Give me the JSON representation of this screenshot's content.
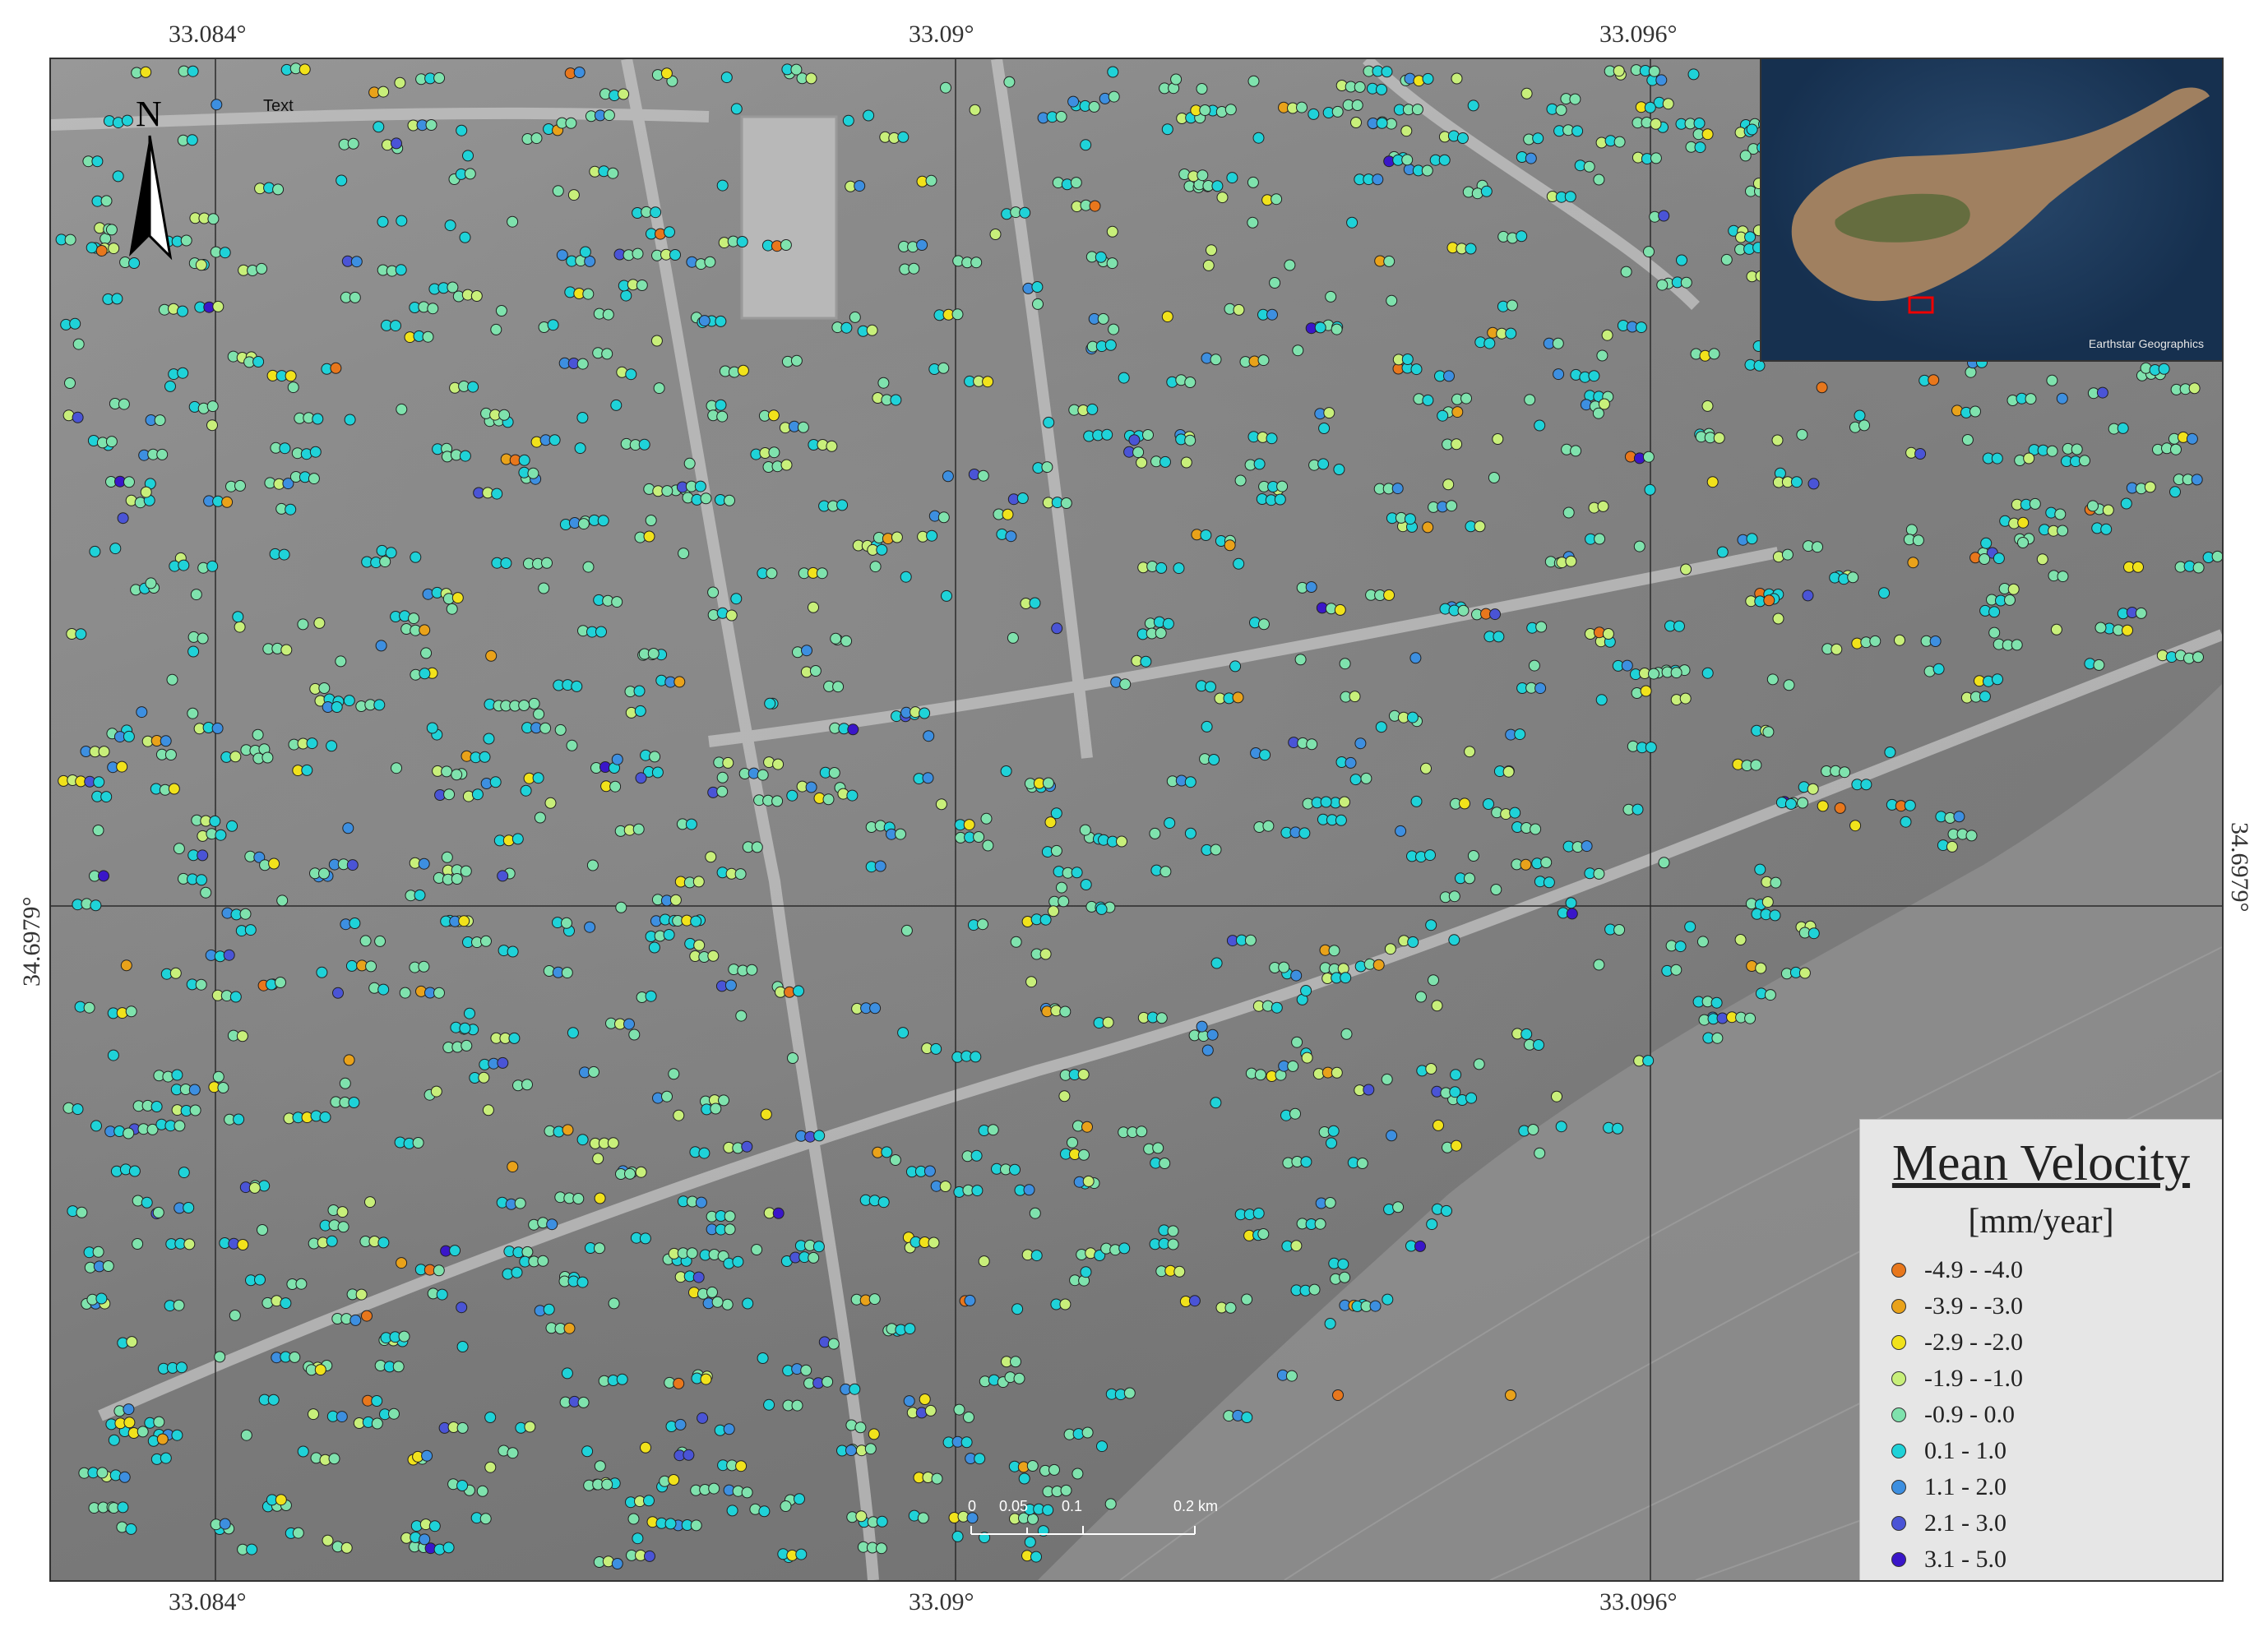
{
  "coordinates": {
    "top": [
      "33.084°",
      "33.09°",
      "33.096°"
    ],
    "bottom": [
      "33.084°",
      "33.09°",
      "33.096°"
    ],
    "left": [
      "34.6979°"
    ],
    "right": [
      "34.6979°"
    ]
  },
  "north_label": "N",
  "map_text": "Text",
  "inset": {
    "credit": "Earthstar Geographics"
  },
  "legend": {
    "title": "Mean Velocity",
    "unit": "[mm/year]",
    "classes": [
      {
        "label": "-4.9 - -4.0",
        "color": "#e8771c"
      },
      {
        "label": "-3.9 - -3.0",
        "color": "#e9a21a"
      },
      {
        "label": "-2.9 - -2.0",
        "color": "#f1e21b"
      },
      {
        "label": "-1.9 - -1.0",
        "color": "#c8ef7a"
      },
      {
        "label": "-0.9 - 0.0",
        "color": "#7fe2ad"
      },
      {
        "label": "0.1 - 1.0",
        "color": "#1fd2d8"
      },
      {
        "label": "1.1 - 2.0",
        "color": "#3d8fe0"
      },
      {
        "label": "2.1 - 3.0",
        "color": "#4a54d6"
      },
      {
        "label": "3.1 - 5.0",
        "color": "#3a16c9"
      }
    ]
  },
  "scale": {
    "labels": [
      "0",
      "0.05",
      "0.1",
      "0.2 km"
    ]
  }
}
